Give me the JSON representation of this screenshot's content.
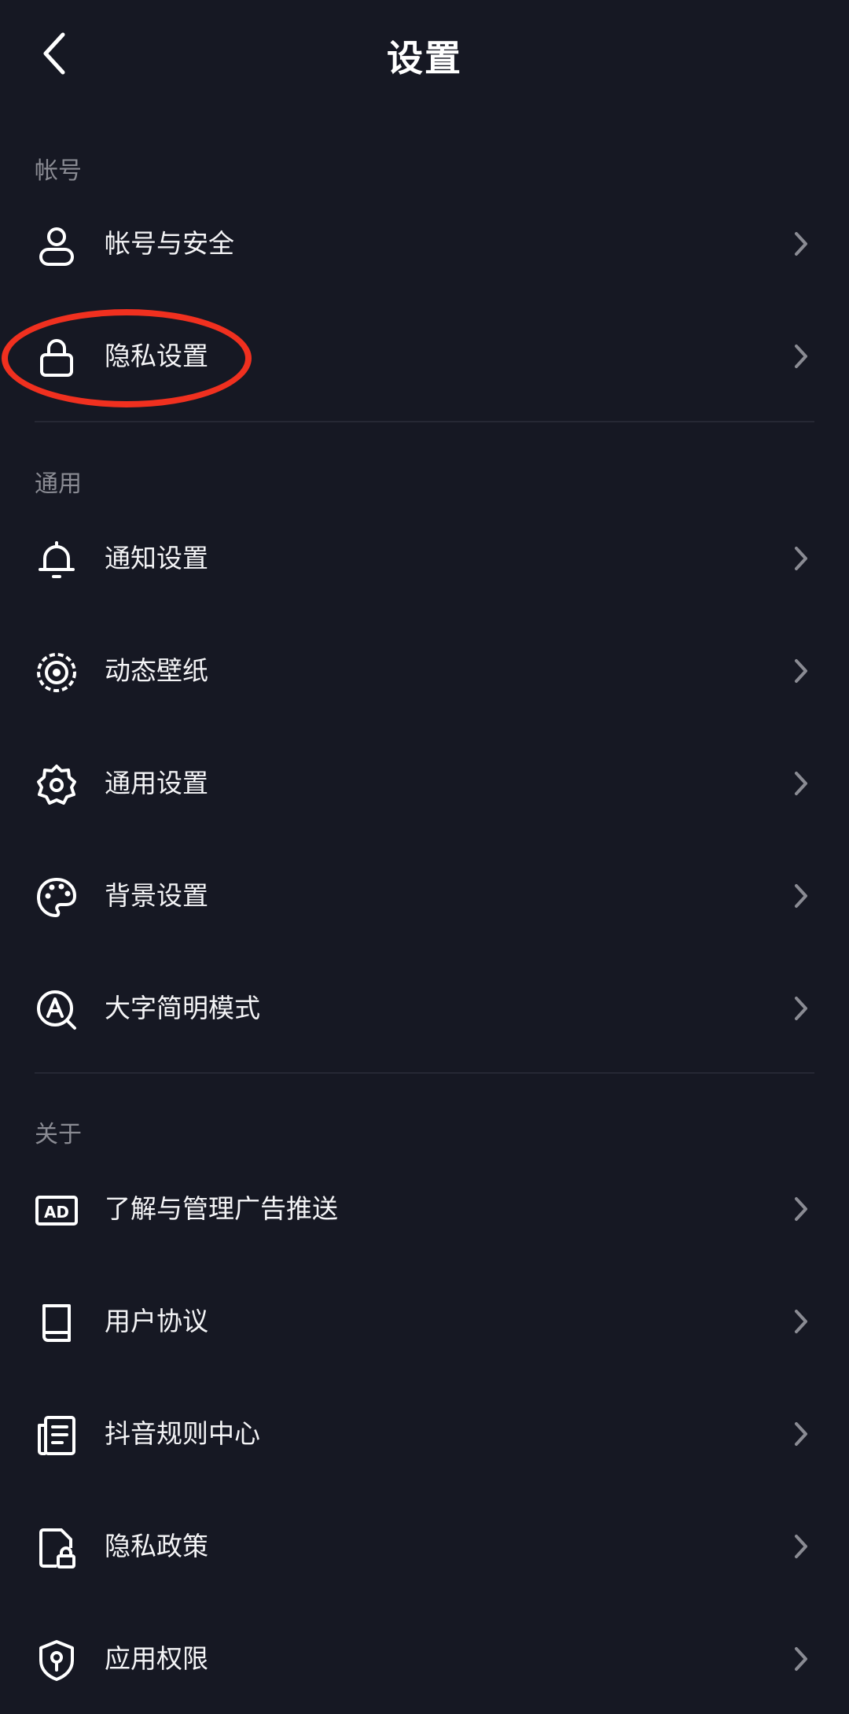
{
  "header": {
    "title": "设置"
  },
  "sections": {
    "account": {
      "title": "帐号",
      "items": [
        {
          "label": "帐号与安全",
          "icon": "user-icon"
        },
        {
          "label": "隐私设置",
          "icon": "lock-icon"
        }
      ]
    },
    "general": {
      "title": "通用",
      "items": [
        {
          "label": "通知设置",
          "icon": "bell-icon"
        },
        {
          "label": "动态壁纸",
          "icon": "live-wallpaper-icon"
        },
        {
          "label": "通用设置",
          "icon": "gear-icon"
        },
        {
          "label": "背景设置",
          "icon": "palette-icon"
        },
        {
          "label": "大字简明模式",
          "icon": "large-font-icon"
        }
      ]
    },
    "about": {
      "title": "关于",
      "items": [
        {
          "label": "了解与管理广告推送",
          "icon": "ad-icon"
        },
        {
          "label": "用户协议",
          "icon": "book-icon"
        },
        {
          "label": "抖音规则中心",
          "icon": "document-icon"
        },
        {
          "label": "隐私政策",
          "icon": "file-lock-icon"
        },
        {
          "label": "应用权限",
          "icon": "shield-icon"
        }
      ]
    }
  },
  "colors": {
    "background": "#161823",
    "highlight": "#f0301f",
    "section_title": "#8a8b93"
  }
}
